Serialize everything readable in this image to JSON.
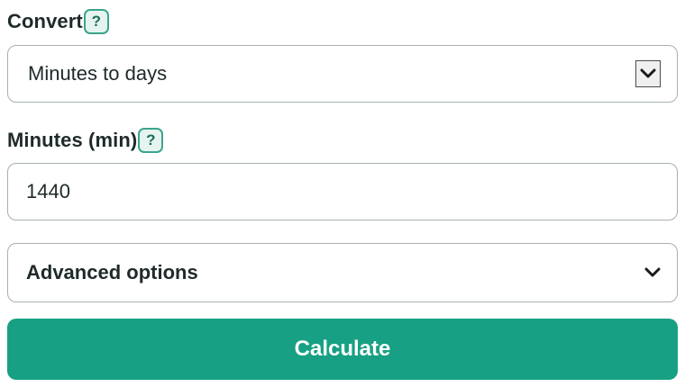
{
  "convert": {
    "label": "Convert",
    "help_label": "?",
    "selected_option": "Minutes to days",
    "arrow_icon": "chevron-down-icon"
  },
  "minutes": {
    "label": "Minutes (min)",
    "help_label": "?",
    "value": "1440"
  },
  "advanced": {
    "label": "Advanced options",
    "arrow_icon": "chevron-down-icon"
  },
  "calculate": {
    "label": "Calculate"
  },
  "colors": {
    "accent": "#17a084",
    "help_border": "#3aa58c",
    "help_bg": "#e6f4ef",
    "border": "#a7b0b0",
    "text": "#1f2a2a"
  }
}
